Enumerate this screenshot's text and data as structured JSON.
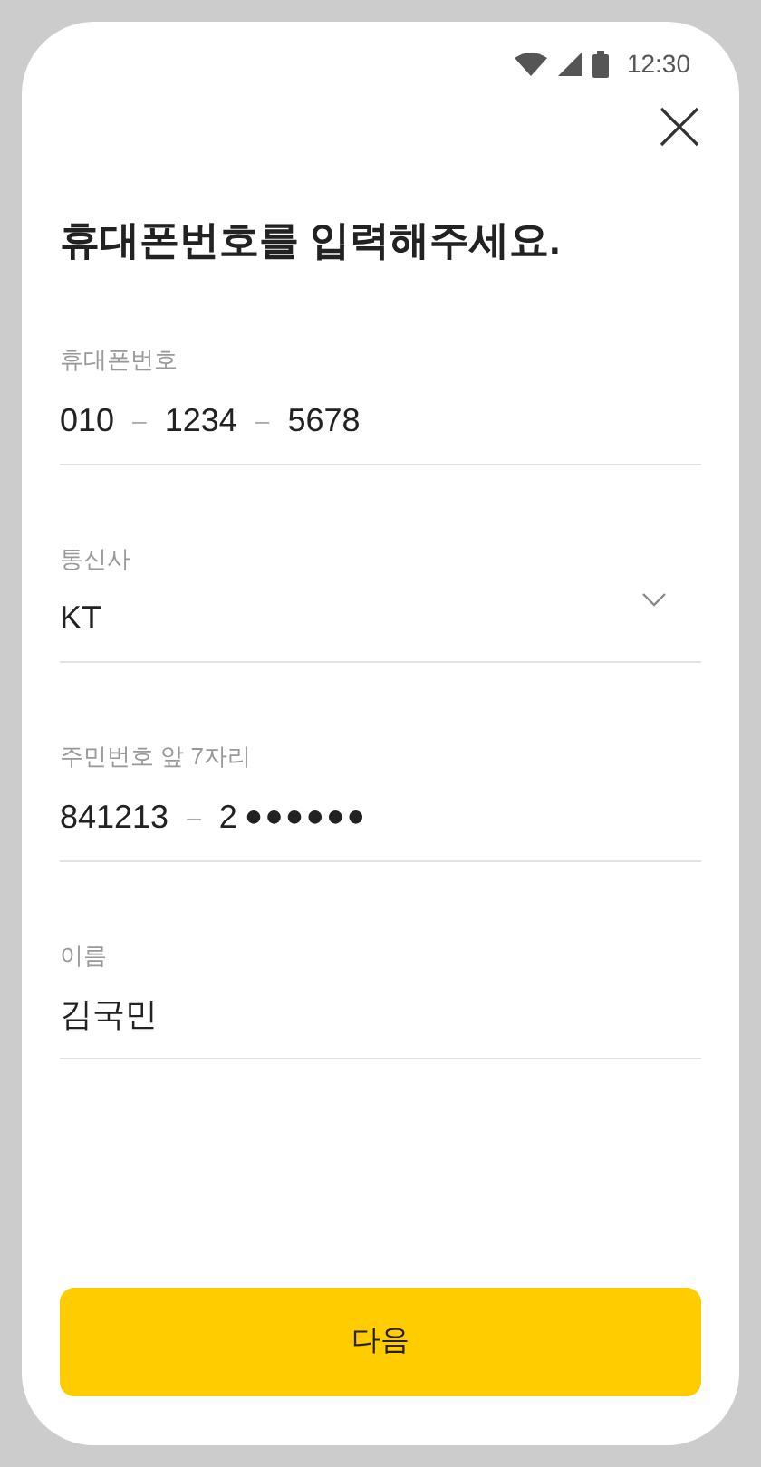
{
  "status_bar": {
    "time": "12:30"
  },
  "title": "휴대폰번호를 입력해주세요.",
  "fields": [
    {
      "kind": "phone",
      "label": "휴대폰번호",
      "parts": [
        "010",
        "1234",
        "5678"
      ],
      "separator": "–"
    },
    {
      "kind": "select",
      "label": "통신사",
      "value": "KT"
    },
    {
      "kind": "rrn",
      "label": "주민번호 앞 7자리",
      "parts": [
        "841213",
        "2"
      ],
      "separator": "–",
      "mask": "●●●●●●"
    },
    {
      "kind": "text",
      "label": "이름",
      "value": "김국민"
    }
  ],
  "next_button": {
    "label": "다음"
  }
}
